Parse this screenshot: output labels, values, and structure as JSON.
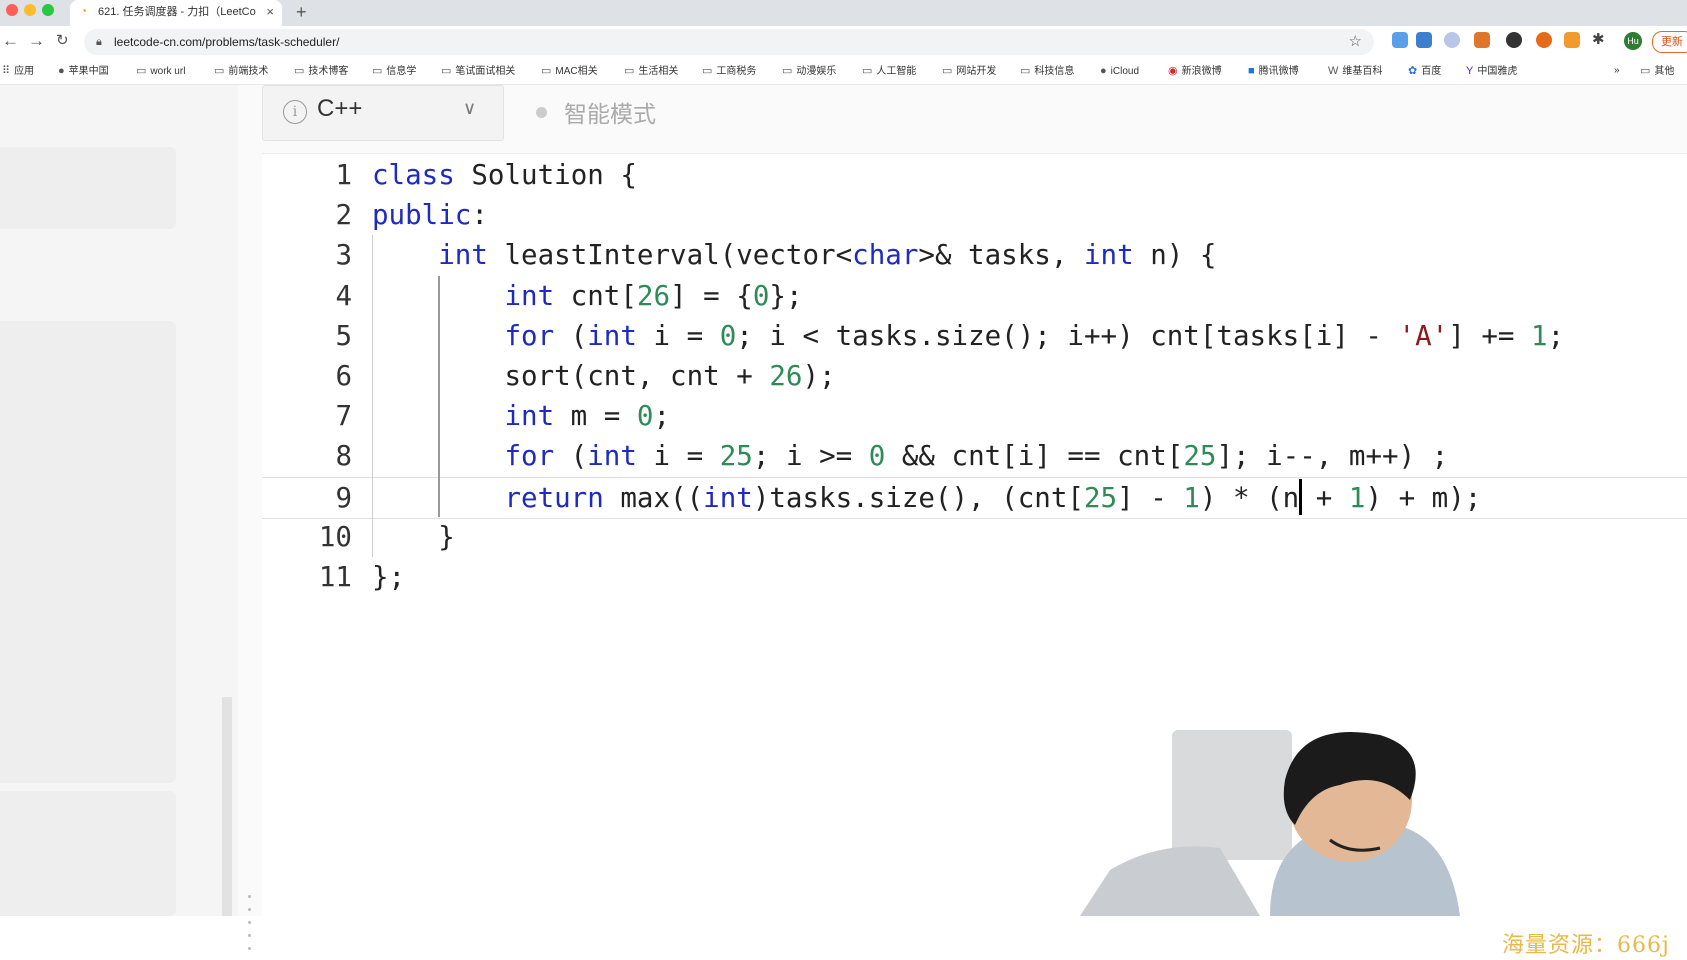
{
  "browser": {
    "tab_title": "621. 任务调度器 - 力扣（LeetCo",
    "tab_close": "×",
    "new_tab": "+",
    "url": "leetcode-cn.com/problems/task-scheduler/",
    "update_label": "更新",
    "profile_initials": "Hu"
  },
  "bookmarks": [
    {
      "label": "应用"
    },
    {
      "label": "苹果中国"
    },
    {
      "label": "work url"
    },
    {
      "label": "前端技术"
    },
    {
      "label": "技术博客"
    },
    {
      "label": "信息学"
    },
    {
      "label": "笔试面试相关"
    },
    {
      "label": "MAC相关"
    },
    {
      "label": "生活相关"
    },
    {
      "label": "工商税务"
    },
    {
      "label": "动漫娱乐"
    },
    {
      "label": "人工智能"
    },
    {
      "label": "网站开发"
    },
    {
      "label": "科技信息"
    },
    {
      "label": "iCloud"
    },
    {
      "label": "新浪微博"
    },
    {
      "label": "腾讯微博"
    },
    {
      "label": "维基百科"
    },
    {
      "label": "百度"
    },
    {
      "label": "中国雅虎"
    }
  ],
  "bookmarks_overflow": "»",
  "bookmarks_other": "其他",
  "editor": {
    "language": "C++",
    "mode_label": "智能模式",
    "info_glyph": "i",
    "chevron": "⌄"
  },
  "code": {
    "line_numbers": [
      "1",
      "2",
      "3",
      "4",
      "5",
      "6",
      "7",
      "8",
      "9",
      "10",
      "11"
    ],
    "lines": [
      "class Solution {",
      "public:",
      "    int leastInterval(vector<char>& tasks, int n) {",
      "        int cnt[26] = {0};",
      "        for (int i = 0; i < tasks.size(); i++) cnt[tasks[i] - 'A'] += 1;",
      "        sort(cnt, cnt + 26);",
      "        int m = 0;",
      "        for (int i = 25; i >= 0 && cnt[i] == cnt[25]; i--, m++) ;",
      "        return max((int)tasks.size(), (cnt[25] - 1) * (n + 1) + m);",
      "    }",
      "};"
    ],
    "active_line": 9,
    "cursor_column": 56
  },
  "watermark": "海量资源：666j"
}
